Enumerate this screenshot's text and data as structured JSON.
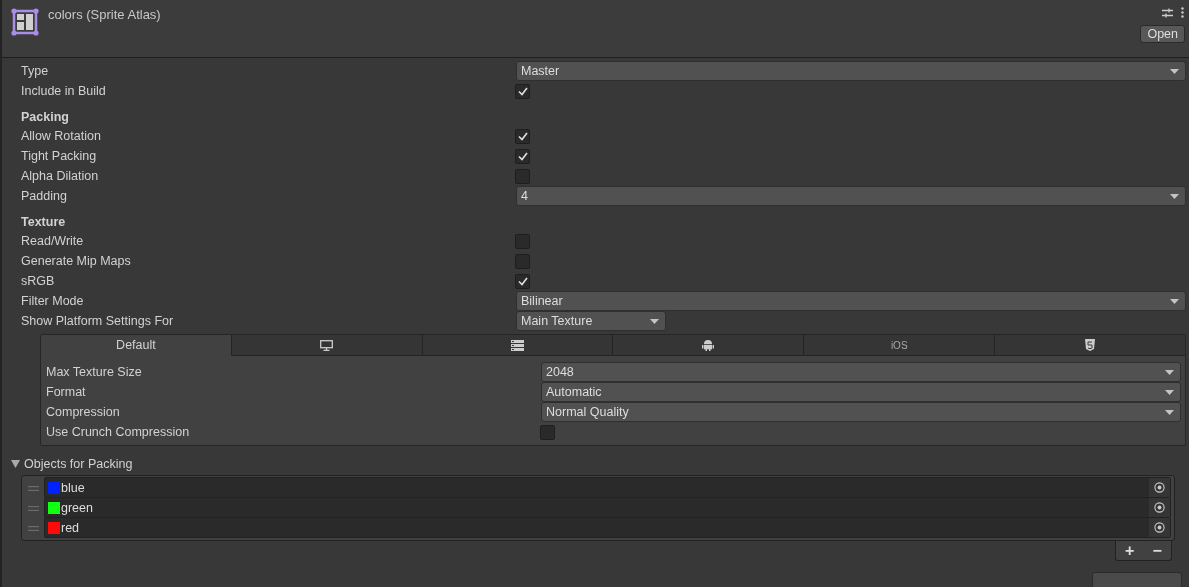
{
  "header": {
    "title": "colors (Sprite Atlas)",
    "button": "Open"
  },
  "fields": [
    {
      "kind": "dropdown",
      "label": "Type",
      "value": "Master"
    },
    {
      "kind": "checkbox",
      "label": "Include in Build",
      "checked": true
    },
    {
      "kind": "heading",
      "label": "Packing"
    },
    {
      "kind": "checkbox",
      "label": "Allow Rotation",
      "checked": true
    },
    {
      "kind": "checkbox",
      "label": "Tight Packing",
      "checked": true
    },
    {
      "kind": "checkbox",
      "label": "Alpha Dilation",
      "checked": false
    },
    {
      "kind": "dropdown",
      "label": "Padding",
      "value": "4"
    },
    {
      "kind": "heading",
      "label": "Texture"
    },
    {
      "kind": "checkbox",
      "label": "Read/Write",
      "checked": false
    },
    {
      "kind": "checkbox",
      "label": "Generate Mip Maps",
      "checked": false
    },
    {
      "kind": "checkbox",
      "label": "sRGB",
      "checked": true
    },
    {
      "kind": "dropdown",
      "label": "Filter Mode",
      "value": "Bilinear"
    },
    {
      "kind": "small-dropdown",
      "label": "Show Platform Settings For",
      "value": "Main Texture"
    }
  ],
  "platform_tabs": [
    {
      "kind": "text",
      "label": "Default",
      "selected": true
    },
    {
      "kind": "monitor",
      "selected": false
    },
    {
      "kind": "server",
      "selected": false
    },
    {
      "kind": "robot",
      "selected": false
    },
    {
      "kind": "text",
      "label": "iOS",
      "selected": false
    },
    {
      "kind": "shield",
      "selected": false
    }
  ],
  "platform_fields": [
    {
      "kind": "dropdown",
      "label": "Max Texture Size",
      "value": "2048"
    },
    {
      "kind": "dropdown",
      "label": "Format",
      "value": "Automatic"
    },
    {
      "kind": "dropdown",
      "label": "Compression",
      "value": "Normal Quality"
    },
    {
      "kind": "checkbox",
      "label": "Use Crunch Compression",
      "checked": false
    }
  ],
  "objects": {
    "label": "Objects for Packing",
    "expanded": true,
    "items": [
      {
        "name": "blue",
        "color": "#0022ff"
      },
      {
        "name": "green",
        "color": "#11ff11"
      },
      {
        "name": "red",
        "color": "#ff0a0a"
      }
    ],
    "add": "+",
    "remove": "−"
  }
}
